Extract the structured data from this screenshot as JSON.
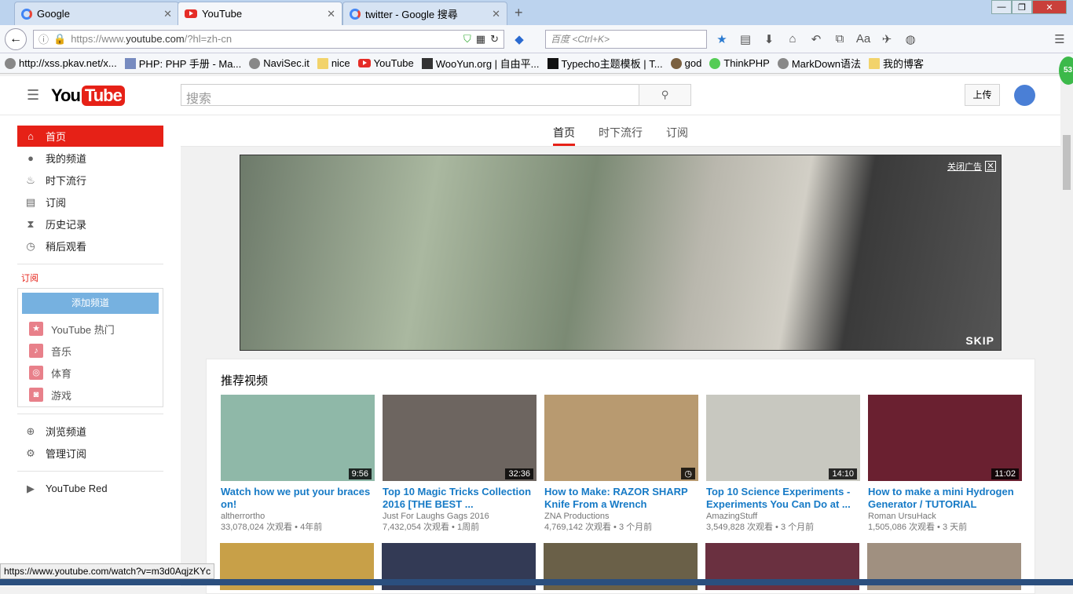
{
  "tabs": [
    {
      "label": "Google",
      "icon": "google-icon"
    },
    {
      "label": "YouTube",
      "icon": "youtube-icon"
    },
    {
      "label": "twitter - Google 搜尋",
      "icon": "google-icon"
    }
  ],
  "url": {
    "prefix": "https://www.",
    "host": "youtube.com",
    "path": "/?hl=zh-cn"
  },
  "search_placeholder": "百度 <Ctrl+K>",
  "bookmarks": [
    "http://xss.pkav.net/x...",
    "PHP: PHP 手册 - Ma...",
    "NaviSec.it",
    "nice",
    "YouTube",
    "WooYun.org | 自由平...",
    "Typecho主题模板 | T...",
    "god",
    "ThinkPHP",
    "MarkDown语法",
    "我的博客"
  ],
  "badge": "53",
  "yt": {
    "logo_you": "You",
    "logo_tube": "Tube",
    "search_placeholder": "搜索",
    "upload": "上传"
  },
  "sidebar": {
    "items": [
      "首页",
      "我的频道",
      "时下流行",
      "订阅",
      "历史记录",
      "稍后观看"
    ],
    "subs_heading": "订阅",
    "add_channel": "添加频道",
    "subs": [
      "YouTube 热门",
      "音乐",
      "体育",
      "游戏"
    ],
    "browse": "浏览频道",
    "manage": "管理订阅",
    "red": "YouTube Red"
  },
  "content_tabs": [
    "首页",
    "时下流行",
    "订阅"
  ],
  "ad": {
    "close": "关闭广告",
    "skip": "SKIP"
  },
  "feed": {
    "title": "推荐视频",
    "videos": [
      {
        "title": "Watch how we put your braces on!",
        "channel": "altherrortho",
        "meta": "33,078,024 次观看 • 4年前",
        "duration": "9:56",
        "color": "#8fb8a8"
      },
      {
        "title": "Top 10 Magic Tricks Collection 2016 [THE BEST ...",
        "channel": "Just For Laughs Gags 2016",
        "meta": "7,432,054 次观看 • 1周前",
        "duration": "32:36",
        "color": "#6d6560"
      },
      {
        "title": "How to Make: RAZOR SHARP Knife From a Wrench",
        "channel": "ZNA Productions",
        "meta": "4,769,142 次观看 • 3 个月前",
        "duration": "",
        "color": "#b89a70"
      },
      {
        "title": "Top 10 Science Experiments - Experiments You Can Do at ...",
        "channel": "AmazingStuff",
        "meta": "3,549,828 次观看 • 3 个月前",
        "duration": "14:10",
        "color": "#c8c8c0"
      },
      {
        "title": "How to make a mini Hydrogen Generator / TUTORIAL",
        "channel": "Roman UrsuHack",
        "meta": "1,505,086 次观看 • 3 天前",
        "duration": "11:02",
        "color": "#6a2030"
      }
    ]
  },
  "status_url": "https://www.youtube.com/watch?v=m3d0AqjzKYc"
}
